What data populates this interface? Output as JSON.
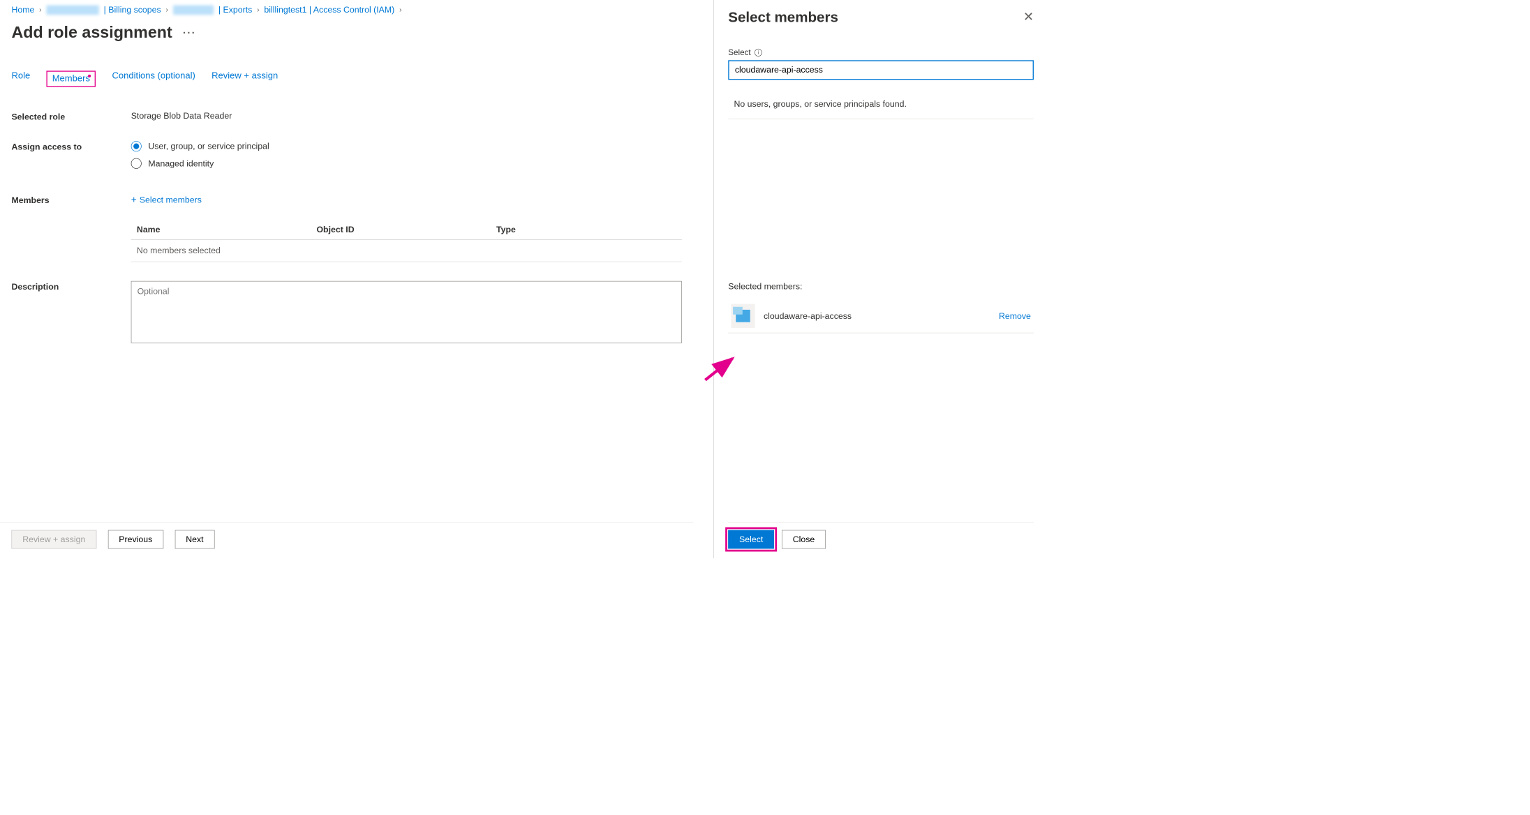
{
  "breadcrumb": {
    "home": "Home",
    "billing_scopes": "| Billing scopes",
    "exports": "| Exports",
    "iam": "billlingtest1 | Access Control (IAM)"
  },
  "page_title": "Add role assignment",
  "tabs": {
    "role": "Role",
    "members": "Members",
    "conditions": "Conditions (optional)",
    "review": "Review + assign"
  },
  "form": {
    "selected_role_label": "Selected role",
    "selected_role_value": "Storage Blob Data Reader",
    "assign_label": "Assign access to",
    "radio_user": "User, group, or service principal",
    "radio_managed": "Managed identity",
    "members_label": "Members",
    "select_members_link": "Select members",
    "description_label": "Description",
    "description_placeholder": "Optional"
  },
  "table": {
    "col_name": "Name",
    "col_object_id": "Object ID",
    "col_type": "Type",
    "empty": "No members selected"
  },
  "footer": {
    "review_assign": "Review + assign",
    "previous": "Previous",
    "next": "Next"
  },
  "panel": {
    "title": "Select members",
    "select_label": "Select",
    "search_value": "cloudaware-api-access",
    "no_results": "No users, groups, or service principals found.",
    "selected_members_label": "Selected members:",
    "selected_member_name": "cloudaware-api-access",
    "remove": "Remove",
    "select_btn": "Select",
    "close_btn": "Close"
  }
}
